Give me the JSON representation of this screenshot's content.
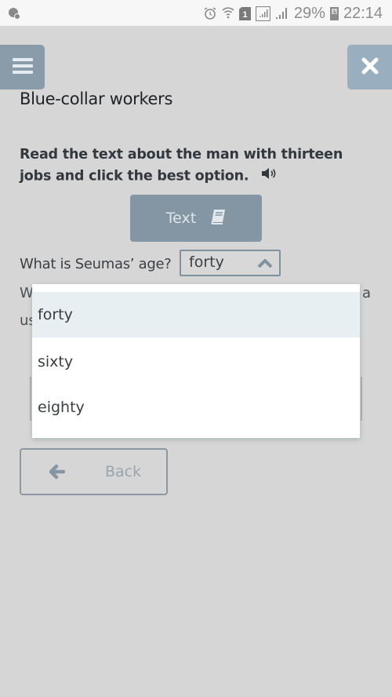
{
  "status_bar": {
    "battery_percent": "29%",
    "time": "22:14",
    "sim_label": "1",
    "icons": [
      "notification-icon",
      "alarm-icon",
      "wifi-icon",
      "sim-icon",
      "signal-icon",
      "signal-icon",
      "battery-icon"
    ]
  },
  "header": {
    "menu_icon": "hamburger-icon",
    "close_icon": "close-icon"
  },
  "page": {
    "title": "Blue-collar workers",
    "instruction": "Read the text about the man with thirteen jobs and click the best option.",
    "audio_icon": "speaker-icon",
    "text_button": {
      "label": "Text",
      "icon": "book-icon"
    },
    "question": {
      "label": "What is Seumas’ age?",
      "selected_value": "forty",
      "options": [
        "forty",
        "sixty",
        "eighty"
      ],
      "highlighted_index": 0
    },
    "obscured_text": {
      "line1_start": "W",
      "line1_end": "a",
      "line2_start": "us"
    },
    "back_button": {
      "label": "Back",
      "icon": "arrow-left-icon"
    }
  },
  "colors": {
    "background": "#d6d6d6",
    "menu_button": "#8a9ca9",
    "close_button": "#99aebf",
    "text_button": "#8496a3",
    "select_border": "#7f929e",
    "dropdown_highlight": "#e8eff2"
  }
}
